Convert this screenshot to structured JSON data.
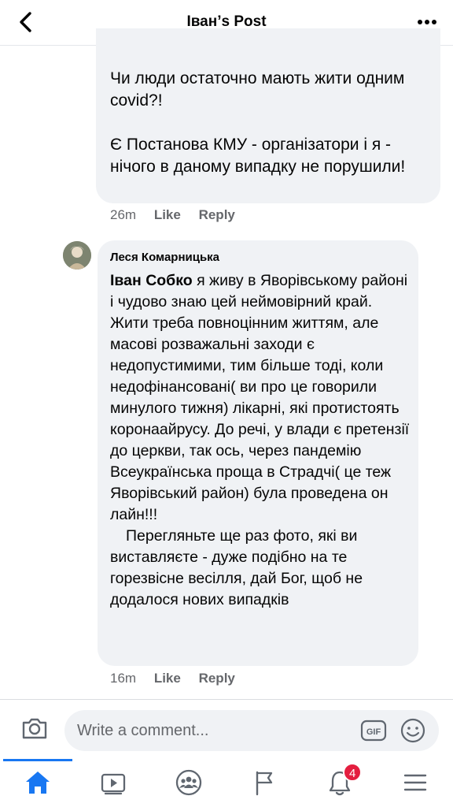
{
  "header": {
    "title": "Іван’s Post"
  },
  "comments": [
    {
      "paragraphs": [
        "Чи люди остаточно мають жити одним covid?!",
        "Є Постанова КМУ - організатори і я - нічого в даному випадку не порушили!"
      ],
      "time": "26m",
      "like": "Like",
      "reply": "Reply"
    },
    {
      "author": "Леся Комарницька",
      "mention": "Іван Собко",
      "text1": " я живу в Яворівському районі і чудово знаю цей неймовірний край. Жити треба повноцінним життям, але масові розважальні заходи є недопустимими, тим більше тоді, коли недофінансовані( ви про це говорили минулого тижня) лікарні, які протистоять коронаайрусу. До речі, у влади є претензії до церкви, так ось, через пандемію Всеукраїнська проща в Страдчі( це теж Яворівський район) була проведена он лайн!!!",
      "text2": "Перегляньте ще раз фото, які ви виставляєте - дуже подібно на те горезвісне весілля, дай Бог, щоб не додалося нових випадків",
      "time": "16m",
      "like": "Like",
      "reply": "Reply"
    }
  ],
  "composer": {
    "placeholder": "Write a comment...",
    "gif_label": "GIF"
  },
  "nav": {
    "items": [
      "home-icon",
      "video-icon",
      "groups-icon",
      "pages-flag-icon",
      "notifications-icon",
      "menu-icon"
    ],
    "notification_count": "4",
    "accent": "#1877f2"
  }
}
